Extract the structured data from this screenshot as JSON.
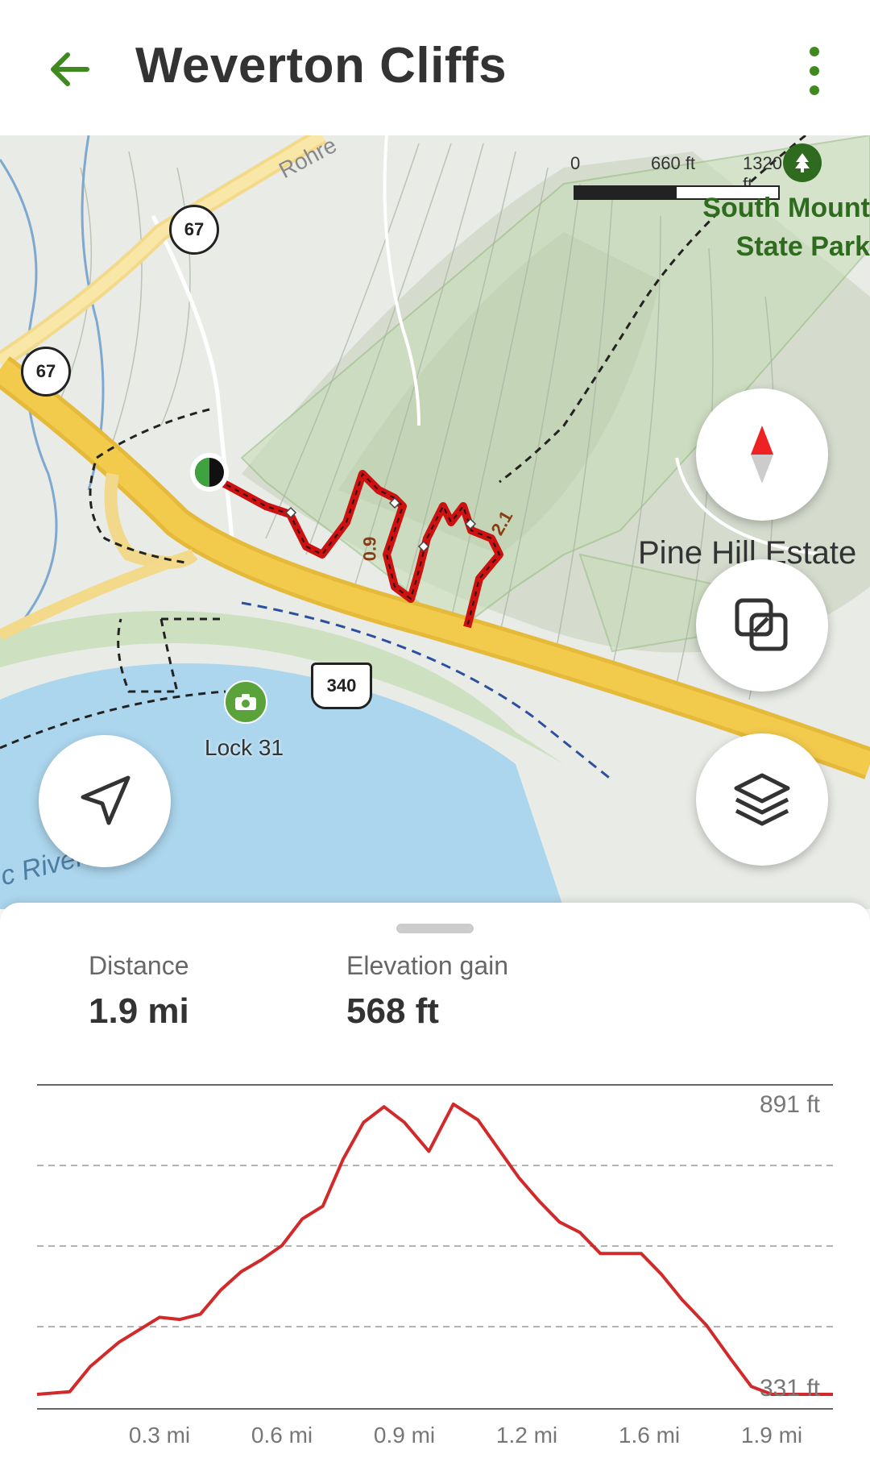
{
  "header": {
    "title": "Weverton Cliffs"
  },
  "map": {
    "scale": {
      "zero": "0",
      "mid": "660 ft",
      "max": "1320 ft"
    },
    "labels": {
      "park_line1": "South Mount",
      "park_line2": "State Park",
      "estate": "Pine Hill Estate",
      "lock": "Lock 31",
      "river": "c River",
      "road_rohrer": "Rohre",
      "route_67a": "67",
      "route_67b": "67",
      "route_340": "340",
      "trail_mile_09": "0.9",
      "trail_mile_21": "2.1"
    }
  },
  "stats": {
    "distance_label": "Distance",
    "distance_value": "1.9 mi",
    "elevation_label": "Elevation gain",
    "elevation_value": "568 ft"
  },
  "chart_data": {
    "type": "line",
    "ylabel_top": "891 ft",
    "ylabel_bottom": "331 ft",
    "ylim": [
      331,
      891
    ],
    "xlim": [
      0,
      1.95
    ],
    "x_ticks": [
      "0.3 mi",
      "0.6 mi",
      "0.9 mi",
      "1.2 mi",
      "1.6 mi",
      "1.9 mi"
    ],
    "x_tick_values": [
      0.3,
      0.6,
      0.9,
      1.2,
      1.5,
      1.8
    ],
    "color": "#d22a2a",
    "series": [
      {
        "x": [
          0.0,
          0.08,
          0.13,
          0.2,
          0.3,
          0.35,
          0.4,
          0.45,
          0.5,
          0.55,
          0.6,
          0.65,
          0.7,
          0.75,
          0.8,
          0.85,
          0.9,
          0.96,
          1.02,
          1.08,
          1.13,
          1.18,
          1.23,
          1.28,
          1.33,
          1.38,
          1.43,
          1.48,
          1.53,
          1.58,
          1.64,
          1.7,
          1.75,
          1.8,
          1.85,
          1.9,
          1.95
        ],
        "y": [
          331,
          336,
          384,
          430,
          478,
          474,
          484,
          530,
          565,
          588,
          615,
          666,
          690,
          780,
          850,
          880,
          850,
          795,
          885,
          855,
          800,
          745,
          700,
          660,
          640,
          600,
          600,
          600,
          560,
          512,
          463,
          398,
          346,
          331,
          331,
          331,
          331
        ]
      }
    ]
  }
}
